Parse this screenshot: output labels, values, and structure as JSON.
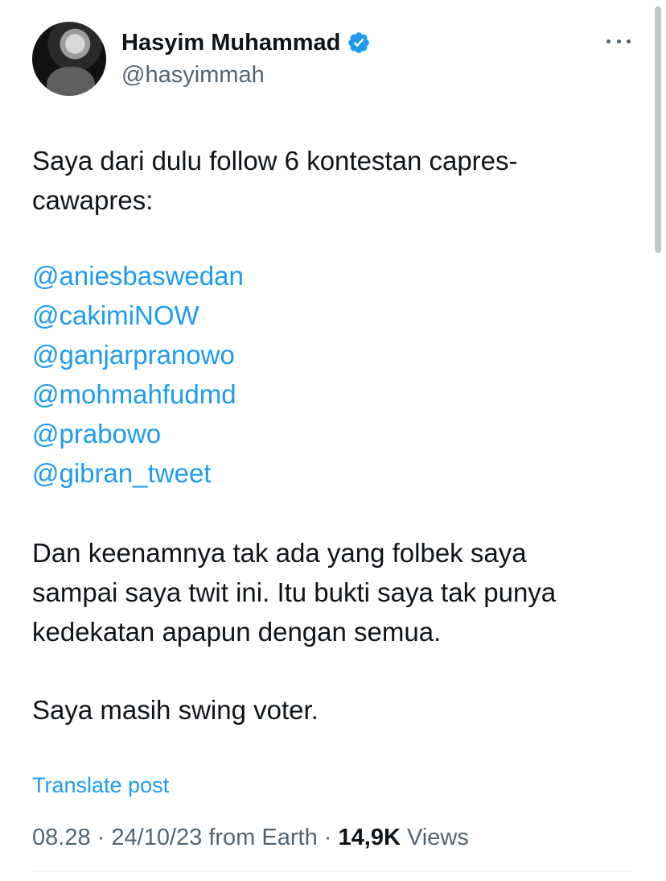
{
  "author": {
    "display_name": "Hasyim Muhammad",
    "handle": "@hasyimmah",
    "verified": true,
    "verified_color": "#1d9bf0"
  },
  "tweet": {
    "paragraph_1": "Saya dari dulu follow 6 kontestan capres-\ncawapres:",
    "mentions": [
      "@aniesbaswedan",
      "@cakimiNOW",
      "@ganjarpranowo",
      "@mohmahfudmd",
      "@prabowo",
      "@gibran_tweet"
    ],
    "paragraph_2": "Dan keenamnya tak ada yang folbek saya\nsampai saya twit ini. Itu bukti saya tak punya\nkedekatan apapun dengan semua.",
    "paragraph_3": "Saya masih swing voter.",
    "translate_label": "Translate post"
  },
  "meta": {
    "time": "08.28",
    "date": "24/10/23",
    "source": "from Earth",
    "separator": "·",
    "view_count": "14,9K",
    "views_label": "Views"
  },
  "icons": {
    "more": "more-horizontal-icon",
    "verified": "verified-badge-icon"
  },
  "colors": {
    "link": "#1d9bf0",
    "secondary_text": "#536471",
    "primary_text": "#0f1419"
  }
}
